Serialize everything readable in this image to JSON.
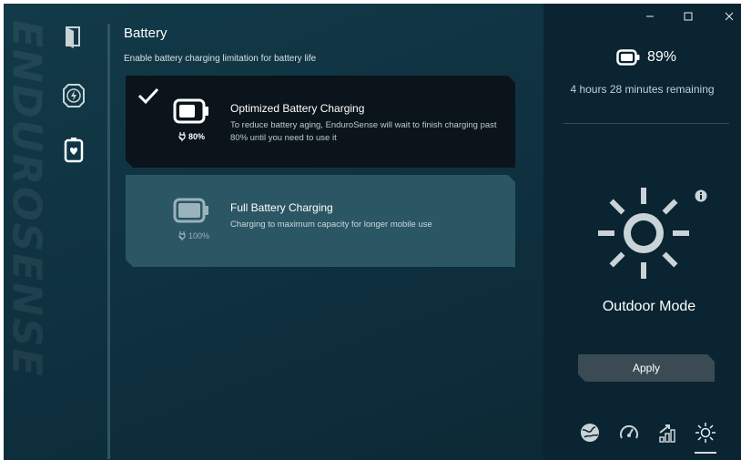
{
  "brand": {
    "text": "ENDUROSENSE"
  },
  "nav": {
    "items": [
      {
        "name": "app-icon"
      },
      {
        "name": "battery-health-icon"
      },
      {
        "name": "battery-charging-icon",
        "selected": true
      }
    ]
  },
  "section": {
    "title": "Battery",
    "subtitle": "Enable battery charging limitation for battery life"
  },
  "options": [
    {
      "selected": true,
      "level": "80%",
      "title": "Optimized Battery Charging",
      "description": "To reduce battery aging, EnduroSense will wait to finish charging past 80% until you need to use it"
    },
    {
      "selected": false,
      "level": "100%",
      "title": "Full Battery Charging",
      "description": "Charging to maximum capacity for longer mobile use"
    }
  ],
  "status": {
    "battery_percent": "89%",
    "remaining": "4 hours 28 minutes remaining"
  },
  "mode": {
    "label": "Outdoor Mode",
    "icon": "sun-icon"
  },
  "apply_label": "Apply",
  "mode_tabs": [
    {
      "name": "eco-globe-icon"
    },
    {
      "name": "speedometer-icon"
    },
    {
      "name": "performance-chart-icon"
    },
    {
      "name": "sun-icon",
      "selected": true
    }
  ],
  "colors": {
    "background": "#0f3140",
    "selected_card": "#0b141a",
    "unselected_card": "#2b5664",
    "right_panel": "#0a2431",
    "apply_button": "#3b4b54"
  }
}
